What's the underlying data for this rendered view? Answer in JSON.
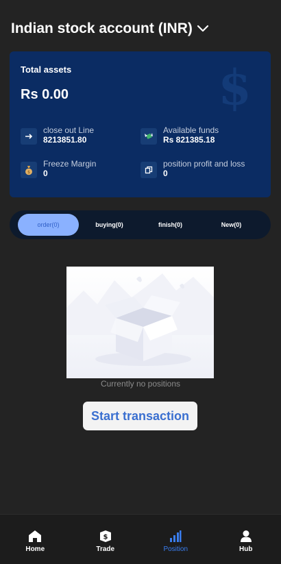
{
  "header": {
    "title": "Indian stock account (INR)"
  },
  "assets": {
    "title": "Total assets",
    "amount": "Rs 0.00",
    "watermark": "$",
    "stats": [
      {
        "label": "close out Line",
        "value": "8213851.80",
        "icon": "arrow-right-icon"
      },
      {
        "label": "Available funds",
        "value": "Rs 821385.18",
        "icon": "money-wings-icon"
      },
      {
        "label": "Freeze Margin",
        "value": "0",
        "icon": "money-bag-icon"
      },
      {
        "label": "position profit and loss",
        "value": "0",
        "icon": "copy-icon"
      }
    ]
  },
  "tabs": [
    {
      "label": "order(0)",
      "active": true
    },
    {
      "label": "buying(0)",
      "active": false
    },
    {
      "label": "finish(0)",
      "active": false
    },
    {
      "label": "New(0)",
      "active": false
    }
  ],
  "empty": {
    "text": "Currently no positions",
    "button": "Start transaction"
  },
  "nav": [
    {
      "label": "Home",
      "icon": "home-icon",
      "active": false
    },
    {
      "label": "Trade",
      "icon": "trade-shield-icon",
      "active": false
    },
    {
      "label": "Position",
      "icon": "bar-chart-icon",
      "active": true
    },
    {
      "label": "Hub",
      "icon": "user-icon",
      "active": false
    }
  ],
  "colors": {
    "background": "#232323",
    "card": "#0b2c63",
    "tabs_bg": "#0d1a2d",
    "active_tab": "#8ab1ff",
    "accent": "#3a7ef0",
    "button_text": "#3a6fd0"
  }
}
